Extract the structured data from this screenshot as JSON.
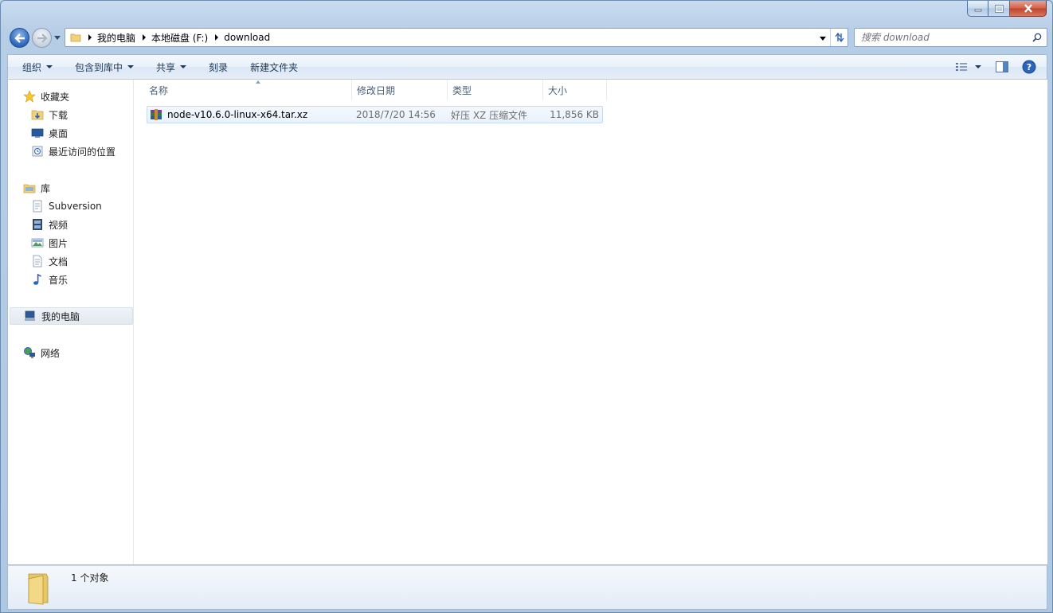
{
  "window": {
    "caption": {
      "minimize": "minimize",
      "maximize": "maximize",
      "close": "close"
    }
  },
  "address": {
    "crumbs": [
      "我的电脑",
      "本地磁盘 (F:)",
      "download"
    ]
  },
  "search": {
    "placeholder": "搜索 download"
  },
  "toolbar": {
    "organize": "组织",
    "include_in_library": "包含到库中",
    "share": "共享",
    "burn": "刻录",
    "new_folder": "新建文件夹"
  },
  "sidebar": {
    "favorites": {
      "label": "收藏夹",
      "items": [
        {
          "label": "下载",
          "icon": "download-folder-icon"
        },
        {
          "label": "桌面",
          "icon": "desktop-icon"
        },
        {
          "label": "最近访问的位置",
          "icon": "recent-places-icon"
        }
      ]
    },
    "libraries": {
      "label": "库",
      "items": [
        {
          "label": "Subversion",
          "icon": "subversion-icon"
        },
        {
          "label": "视频",
          "icon": "video-icon"
        },
        {
          "label": "图片",
          "icon": "pictures-icon"
        },
        {
          "label": "文档",
          "icon": "documents-icon"
        },
        {
          "label": "音乐",
          "icon": "music-icon"
        }
      ]
    },
    "computer": {
      "label": "我的电脑"
    },
    "network": {
      "label": "网络"
    }
  },
  "columns": {
    "name": "名称",
    "date": "修改日期",
    "type": "类型",
    "size": "大小"
  },
  "files": [
    {
      "name": "node-v10.6.0-linux-x64.tar.xz",
      "date": "2018/7/20 14:56",
      "type": "好压 XZ 压缩文件",
      "size": "11,856 KB"
    }
  ],
  "status": {
    "count": "1 个对象"
  },
  "colors": {
    "selection": "#e9f2fc",
    "accent": "#1e395b",
    "window_frame": "#b9d1ea"
  }
}
